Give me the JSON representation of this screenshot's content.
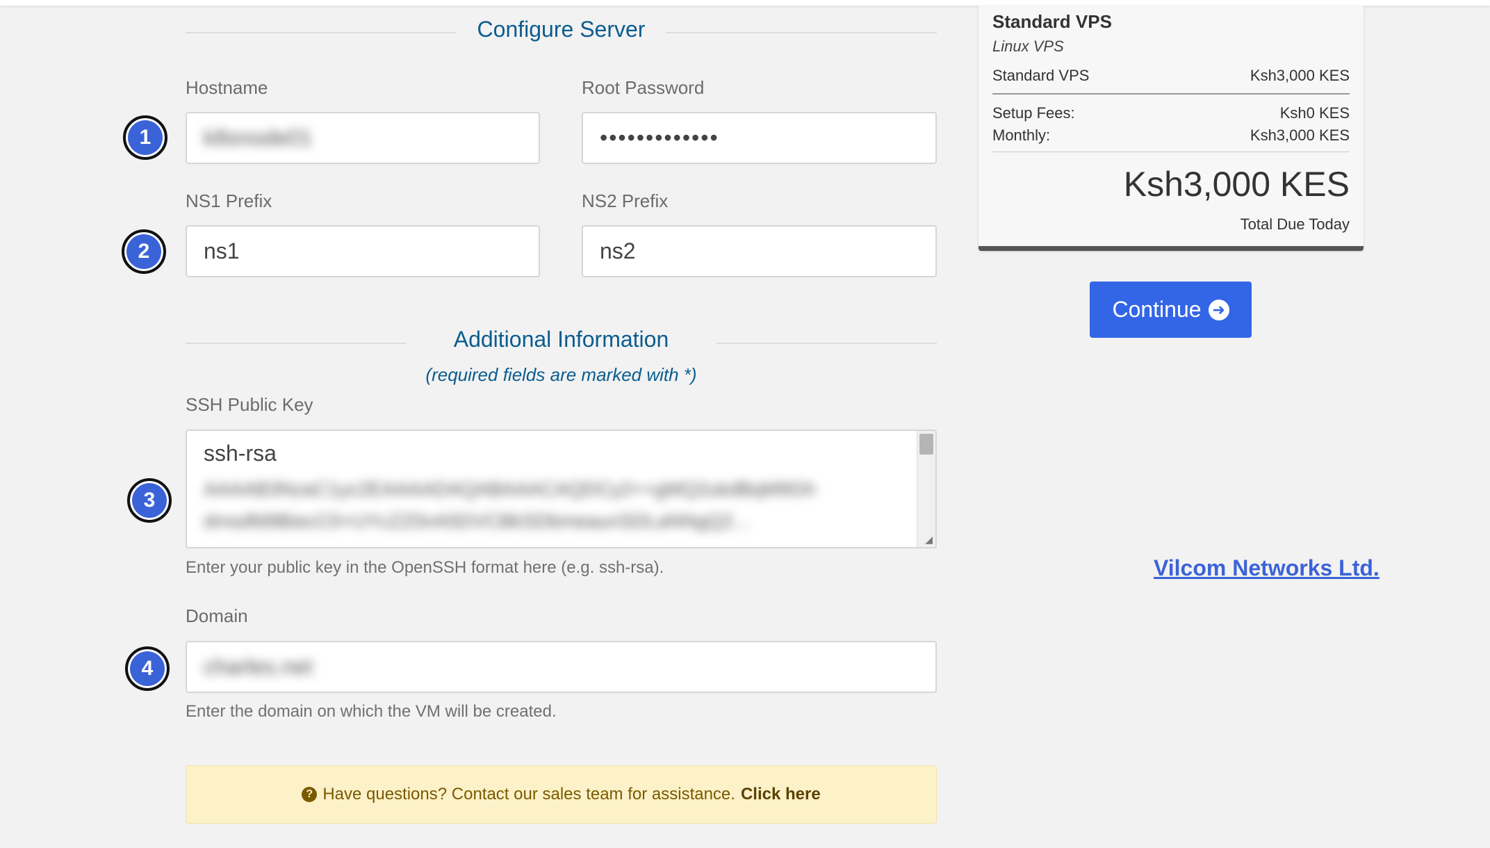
{
  "sections": {
    "configure": "Configure Server",
    "additional": "Additional Information",
    "required_note": "(required fields are marked with *)"
  },
  "fields": {
    "hostname": {
      "label": "Hostname",
      "value": "k8snode01"
    },
    "root_password": {
      "label": "Root Password",
      "value": "•••••••••••••"
    },
    "ns1": {
      "label": "NS1 Prefix",
      "value": "ns1"
    },
    "ns2": {
      "label": "NS2 Prefix",
      "value": "ns2"
    },
    "ssh_key": {
      "label": "SSH Public Key",
      "value_line1": "ssh-rsa",
      "value_blur1": "AAAAB3NzaC1yc2EAAAADAQABAAACAQDCy2++gMQ2ukdBqM9Gh",
      "value_blur2": "dmsdfd9BiecC0+UYcZZ0nA5DVCBkSDbmeaunSDLaNNgQ2...",
      "help": "Enter your public key in the OpenSSH format here (e.g. ssh-rsa)."
    },
    "domain": {
      "label": "Domain",
      "value": "charles.net",
      "help": "Enter the domain on which the VM will be created."
    }
  },
  "badges": [
    "1",
    "2",
    "3",
    "4"
  ],
  "summary": {
    "title": "Standard VPS",
    "subtitle": "Linux VPS",
    "item_name": "Standard VPS",
    "item_price": "Ksh3,000 KES",
    "setup_label": "Setup Fees:",
    "setup_value": "Ksh0 KES",
    "monthly_label": "Monthly:",
    "monthly_value": "Ksh3,000 KES",
    "total": "Ksh3,000 KES",
    "total_label": "Total Due Today"
  },
  "continue_label": "Continue",
  "company_link": "Vilcom Networks Ltd.",
  "notice": {
    "text": "Have questions? Contact our sales team for assistance.",
    "link": "Click here"
  },
  "colors": {
    "accent": "#3366e6",
    "heading": "#0a5d8f",
    "badge": "#3b63d8",
    "notice_bg": "#fcf1c8"
  }
}
